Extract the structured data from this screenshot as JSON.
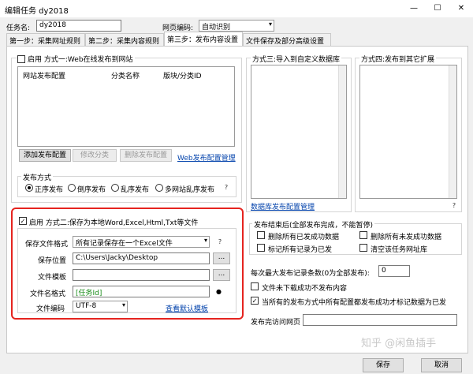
{
  "window": {
    "title": "编辑任务 dy2018",
    "minimize": "—",
    "maximize": "☐",
    "close": "✕"
  },
  "header": {
    "task_name_label": "任务名:",
    "task_name_value": "dy2018",
    "encoding_label": "网页编码:",
    "encoding_value": "自动识别"
  },
  "tabs": [
    "第一步：采集网址规则",
    "第二步：采集内容规则",
    "第三步：发布内容设置",
    "文件保存及部分高级设置"
  ],
  "method1": {
    "enable_label": "启用",
    "title": "方式一:Web在线发布到网站",
    "columns": [
      "网站发布配置",
      "分类名称",
      "版块/分类ID"
    ],
    "buttons": {
      "add": "添加发布配置",
      "edit_category": "修改分类",
      "delete": "删除发布配置"
    },
    "manage_link": "Web发布配置管理",
    "publish_mode_label": "发布方式",
    "modes": [
      "正序发布",
      "倒序发布",
      "乱序发布",
      "多网站乱序发布"
    ]
  },
  "method3": {
    "title": "方式三:导入到自定义数据库",
    "manage_link": "数据库发布配置管理"
  },
  "method4": {
    "title": "方式四:发布到其它扩展"
  },
  "method2": {
    "enable_label": "启用",
    "title": "方式二:保存为本地Word,Excel,Html,Txt等文件",
    "format_label": "保存文件格式",
    "format_value": "所有记录保存在一个Excel文件",
    "location_label": "保存位置",
    "location_value": "C:\\Users\\Jacky\\Desktop",
    "template_label": "文件模板",
    "template_value": "",
    "filename_label": "文件名格式",
    "filename_value": "[任务Id]",
    "encoding_label": "文件编码",
    "encoding_value": "UTF-8",
    "default_template_link": "查看默认模板",
    "browse": "..."
  },
  "after_publish": {
    "title": "发布结束后(全部发布完成，不能暂停)",
    "options": [
      "删除所有已发成功数据",
      "删除所有未发成功数据",
      "标记所有记录为已发",
      "清空该任务网址库"
    ]
  },
  "max_records": {
    "label": "每次最大发布记录条数(0为全部发布):",
    "value": "0"
  },
  "no_publish_missing": "文件未下载成功不发布内容",
  "all_success_mark": "当所有的发布方式中所有配置都发布成功才标记数据为已发",
  "visit_url_label": "发布完访问网页",
  "watermark": "知乎 @闲鱼插手",
  "footer": {
    "save": "保存",
    "cancel": "取消"
  }
}
